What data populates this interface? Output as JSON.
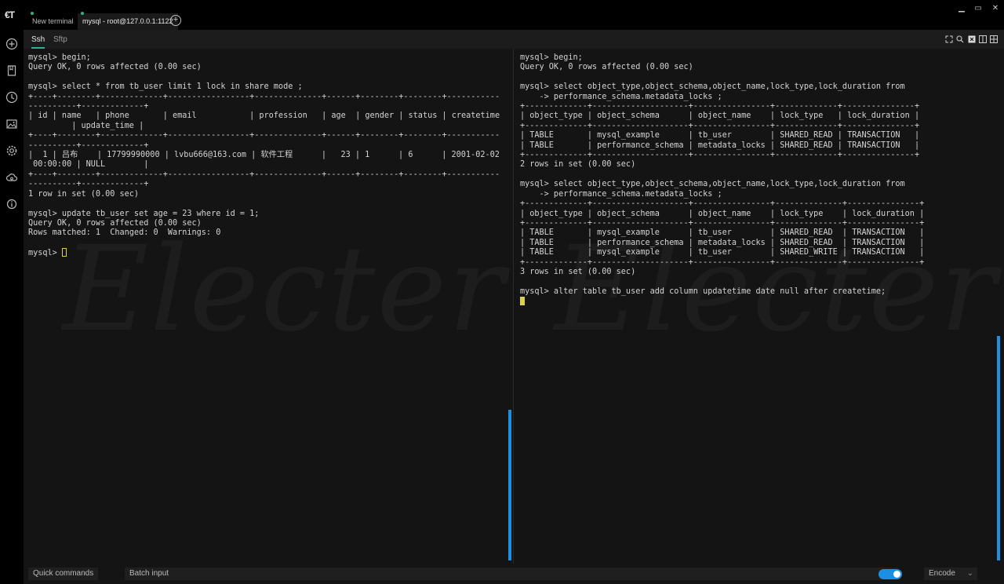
{
  "app": {
    "logo_text": "€T"
  },
  "tabs": [
    {
      "label": "New terminal",
      "active": false
    },
    {
      "label": "mysql - root@127.0.0.1:1122",
      "active": true
    }
  ],
  "tab_add": "+",
  "window": {
    "minimize": "▁",
    "restore": "▭",
    "close": "✕"
  },
  "subtabs": {
    "ssh": "Ssh",
    "sftp": "Sftp"
  },
  "sidebar_icons": [
    "add-icon",
    "bookmark-icon",
    "history-icon",
    "image-icon",
    "settings-icon",
    "cloud-sync-icon",
    "info-icon"
  ],
  "watermark": "Electerm",
  "terminal_left": {
    "content": "mysql> begin;\nQuery OK, 0 rows affected (0.00 sec)\n\nmysql> select * from tb_user limit 1 lock in share mode ;\n+----+--------+-------------+-----------------+--------------+------+--------+--------+-----------\n----------+-------------+\n| id | name   | phone       | email           | profession   | age  | gender | status | createtime\n         | update_time |\n+----+--------+-------------+-----------------+--------------+------+--------+--------+-----------\n----------+-------------+\n|  1 | 吕布    | 17799990000 | lvbu666@163.com | 软件工程      |   23 | 1      | 6      | 2001-02-02\n 00:00:00 | NULL        |\n+----+--------+-------------+-----------------+--------------+------+--------+--------+-----------\n----------+-------------+\n1 row in set (0.00 sec)\n\nmysql> update tb_user set age = 23 where id = 1;\nQuery OK, 0 rows affected (0.00 sec)\nRows matched: 1  Changed: 0  Warnings: 0\n\nmysql> "
  },
  "terminal_right": {
    "content": "mysql> begin;\nQuery OK, 0 rows affected (0.00 sec)\n\nmysql> select object_type,object_schema,object_name,lock_type,lock_duration from\n    -> performance_schema.metadata_locks ;\n+-------------+--------------------+----------------+-------------+---------------+\n| object_type | object_schema      | object_name    | lock_type   | lock_duration |\n+-------------+--------------------+----------------+-------------+---------------+\n| TABLE       | mysql_example      | tb_user        | SHARED_READ | TRANSACTION   |\n| TABLE       | performance_schema | metadata_locks | SHARED_READ | TRANSACTION   |\n+-------------+--------------------+----------------+-------------+---------------+\n2 rows in set (0.00 sec)\n\nmysql> select object_type,object_schema,object_name,lock_type,lock_duration from\n    -> performance_schema.metadata_locks ;\n+-------------+--------------------+----------------+--------------+---------------+\n| object_type | object_schema      | object_name    | lock_type    | lock_duration |\n+-------------+--------------------+----------------+--------------+---------------+\n| TABLE       | mysql_example      | tb_user        | SHARED_READ  | TRANSACTION   |\n| TABLE       | performance_schema | metadata_locks | SHARED_READ  | TRANSACTION   |\n| TABLE       | mysql_example      | tb_user        | SHARED_WRITE | TRANSACTION   |\n+-------------+--------------------+----------------+--------------+---------------+\n3 rows in set (0.00 sec)\n\nmysql> alter table tb_user add column updatetime date null after createtime;\n"
  },
  "bottom": {
    "quick_commands": "Quick commands",
    "batch_input": "Batch input",
    "encode": "Encode",
    "encode_arrow": "⌄"
  },
  "colors": {
    "accent": "#1c8fe3",
    "cursor": "#d9d24a",
    "green": "#2ab58f"
  }
}
